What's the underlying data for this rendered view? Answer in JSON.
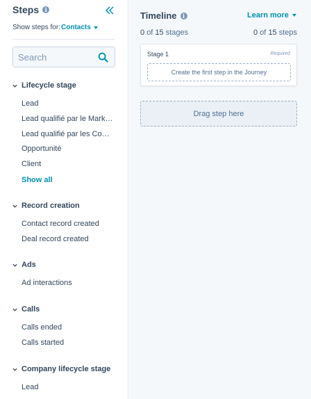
{
  "steps": {
    "title": "Steps",
    "show_for_label": "Show steps for:",
    "show_for_value": "Contacts",
    "search_placeholder": "Search",
    "sections": [
      {
        "title": "Lifecycle stage",
        "items": [
          "Lead",
          "Lead qualifié par le Marketing",
          "Lead qualifié par les Commerciaux",
          "Opportunité",
          "Client"
        ],
        "show_all": "Show all"
      },
      {
        "title": "Record creation",
        "items": [
          "Contact record created",
          "Deal record created"
        ]
      },
      {
        "title": "Ads",
        "items": [
          "Ad interactions"
        ]
      },
      {
        "title": "Calls",
        "items": [
          "Calls ended",
          "Calls started"
        ]
      },
      {
        "title": "Company lifecycle stage",
        "items": [
          "Lead"
        ]
      }
    ]
  },
  "timeline": {
    "title": "Timeline",
    "learn_more": "Learn more",
    "stages_current": "0",
    "stages_of": "of",
    "stages_total": "15",
    "stages_word": "stages",
    "steps_current": "0",
    "steps_of": "of",
    "steps_total": "15",
    "steps_word": "steps",
    "stage_name": "Stage 1",
    "stage_required": "Required",
    "first_step_label": "Create the first step in the Journey",
    "drag_label": "Drag step here"
  },
  "colors": {
    "accent": "#0091ae",
    "text": "#33475b",
    "panel_bg": "#f5f8fa",
    "border": "#dfe3eb"
  },
  "icons": {
    "info": "info-icon",
    "collapse": "double-chevron-left-icon",
    "search": "search-icon",
    "section_toggle": "chevron-down-icon",
    "dropdown": "caret-down-icon"
  }
}
